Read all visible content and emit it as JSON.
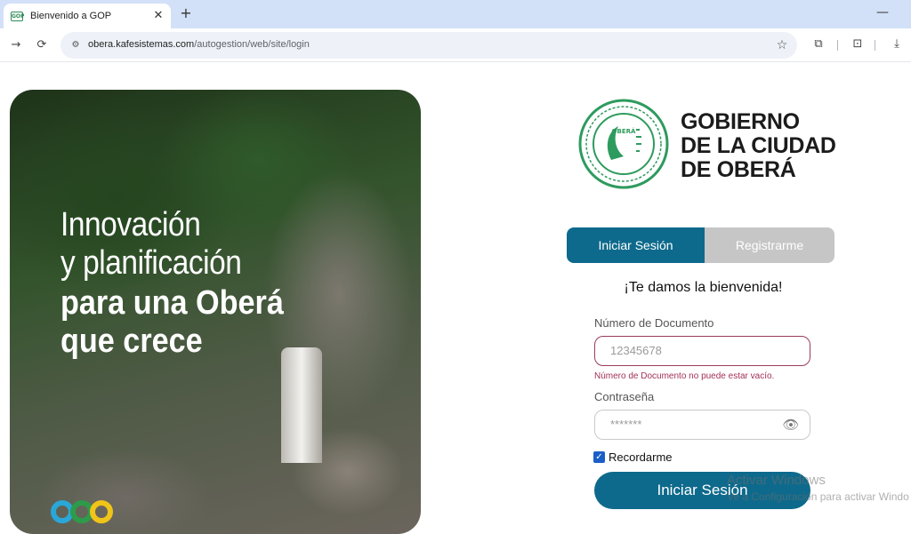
{
  "browser": {
    "tab_title": "Bienvenido a GOP",
    "favicon_text": "GOP",
    "url_host": "obera.kafesistemas.com",
    "url_path": "/autogestion/web/site/login",
    "icons": {
      "close": "✕",
      "new_tab": "+",
      "minimize": "—",
      "back": "→",
      "reload": "⟳",
      "site_info": "⚙",
      "bookmark": "☆",
      "extensions": "⧉",
      "screenshot": "⊡",
      "download": "⤓"
    }
  },
  "hero": {
    "line1": "Innovación",
    "line2": "y planificación",
    "line3": "para una Oberá",
    "line4": "que crece",
    "logo_colors": [
      "#2aa7d8",
      "#2e9b4a",
      "#f0c419"
    ]
  },
  "brand": {
    "line1": "GOBIERNO",
    "line2": "DE LA CIUDAD",
    "line3": "DE OBERÁ",
    "seal_text": "OBERÁ",
    "seal_color": "#2e9b5e"
  },
  "auth_tabs": {
    "login": "Iniciar Sesión",
    "register": "Registrarme"
  },
  "form": {
    "welcome": "¡Te damos la bienvenida!",
    "document_label": "Número de Documento",
    "document_placeholder": "12345678",
    "document_error": "Número de Documento no puede estar vacío.",
    "password_label": "Contraseña",
    "password_placeholder": "*******",
    "eye_icon": "👁",
    "remember_label": "Recordarme",
    "remember_checked_glyph": "✓",
    "submit_label": "Iniciar Sesión"
  },
  "overlay": {
    "watermark_title": "Activar Windows",
    "watermark_sub": "Ve a Configuración para activar Windo"
  },
  "colors": {
    "primary": "#0e6a8c",
    "error": "#a3305a",
    "inactive_tab": "#c6c6c6"
  }
}
